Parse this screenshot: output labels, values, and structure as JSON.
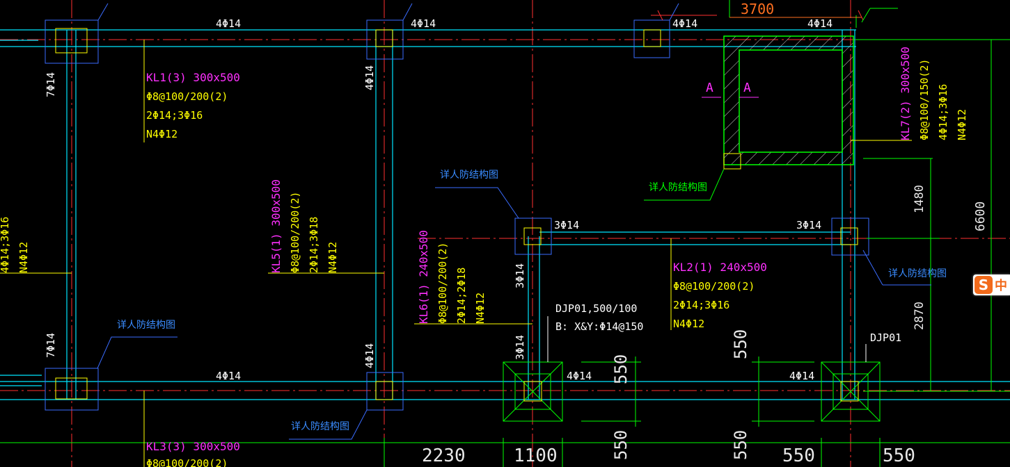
{
  "colors": {
    "background": "#000000",
    "beam": "#00ffff",
    "axis": "#ff3030",
    "dimension": "#00ff00",
    "label_magenta": "#ff30ff",
    "label_yellow": "#ffff00",
    "leader_blue": "#3060ff",
    "column": "#3a6cff",
    "dim_text": "#e8e8e8"
  },
  "beams": {
    "kl1": {
      "name": "KL1(3) 300x500",
      "stirrup": "Φ8@100/200(2)",
      "bars": "2Φ14;3Φ16",
      "waist": "N4Φ12"
    },
    "kl2": {
      "name": "KL2(1) 240x500",
      "stirrup": "Φ8@100/200(2)",
      "bars": "2Φ14;3Φ16",
      "waist": "N4Φ12"
    },
    "kl3": {
      "name": "KL3(3) 300x500",
      "stirrup": "Φ8@100/200(2)"
    },
    "kl5": {
      "name": "KL5(1) 300x500",
      "stirrup": "Φ8@100/200(2)",
      "bars": "2Φ14;3Φ18",
      "waist": "N4Φ12"
    },
    "kl6": {
      "name": "KL6(1) 240x500",
      "stirrup": "Φ8@100/200(2)",
      "bars": "2Φ14;2Φ18",
      "waist": "N4Φ12"
    },
    "kl7": {
      "name": "KL7(2) 300x500",
      "stirrup": "Φ8@100/150(2)",
      "bars": "4Φ14;3Φ16",
      "waist": "N4Φ12"
    },
    "left_partial": {
      "bars": "4Φ14;3Φ16",
      "waist": "N4Φ12"
    }
  },
  "rebar_labels": {
    "four_14": "4Φ14",
    "three_14": "3Φ14",
    "seven_14": "7Φ14"
  },
  "notes": {
    "see_detail": "详人防结构图"
  },
  "footing": {
    "djp01_spec": "DJP01,500/100",
    "djp01_bars": "B: X&Y:Φ14@150",
    "djp01": "DJP01"
  },
  "section_marks": {
    "a": "A"
  },
  "dimensions": {
    "d3700": "3700",
    "d6600": "6600",
    "d1480": "1480",
    "d2870": "2870",
    "d550": "550",
    "d2230": "2230",
    "d1100": "1100"
  },
  "ime": {
    "icon": "S",
    "char": "中"
  }
}
